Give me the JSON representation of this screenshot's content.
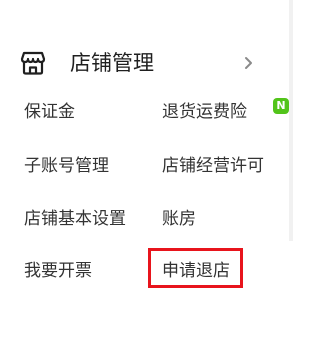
{
  "menu": {
    "title": "店铺管理",
    "icon": "store-icon",
    "chevron": "chevron-right-icon",
    "items": [
      {
        "label": "保证金"
      },
      {
        "label": "退货运费险",
        "badge": "N"
      },
      {
        "label": "子账号管理"
      },
      {
        "label": "店铺经营许可"
      },
      {
        "label": "店铺基本设置"
      },
      {
        "label": "账房"
      },
      {
        "label": "我要开票"
      },
      {
        "label": "申请退店",
        "highlighted": true
      }
    ]
  },
  "colors": {
    "highlight_border": "#e8141c",
    "badge_bg": "#52c41a",
    "text": "#333333"
  }
}
